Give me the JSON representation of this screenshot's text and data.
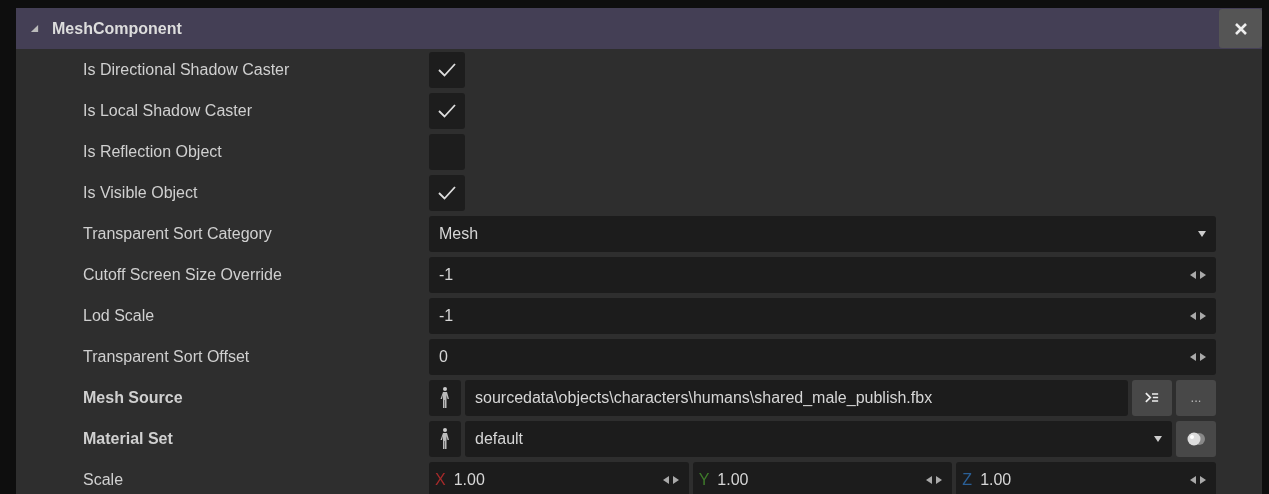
{
  "panel": {
    "title": "MeshComponent",
    "expanded": true
  },
  "rows": [
    {
      "kind": "checkbox",
      "label": "Is Directional Shadow Caster",
      "bold": false,
      "checked": true
    },
    {
      "kind": "checkbox",
      "label": "Is Local Shadow Caster",
      "bold": false,
      "checked": true
    },
    {
      "kind": "checkbox",
      "label": "Is Reflection Object",
      "bold": false,
      "checked": false
    },
    {
      "kind": "checkbox",
      "label": "Is Visible Object",
      "bold": false,
      "checked": true
    },
    {
      "kind": "dropdown",
      "label": "Transparent Sort Category",
      "bold": false,
      "value": "Mesh"
    },
    {
      "kind": "number",
      "label": "Cutoff Screen Size Override",
      "bold": false,
      "value": "-1"
    },
    {
      "kind": "number",
      "label": "Lod Scale",
      "bold": false,
      "value": "-1"
    },
    {
      "kind": "number",
      "label": "Transparent Sort Offset",
      "bold": false,
      "value": "0"
    },
    {
      "kind": "asset",
      "label": "Mesh Source",
      "bold": true,
      "value": "sourcedata\\objects\\characters\\humans\\shared_male_publish.fbx",
      "browse": "..."
    },
    {
      "kind": "material",
      "label": "Material Set",
      "bold": true,
      "value": "default"
    },
    {
      "kind": "vector",
      "label": "Scale",
      "bold": false,
      "components": [
        {
          "axis": "X",
          "value": "1.00",
          "color": "#a52a2a"
        },
        {
          "axis": "Y",
          "value": "1.00",
          "color": "#3e7a2a"
        },
        {
          "axis": "Z",
          "value": "1.00",
          "color": "#2a5f96"
        }
      ]
    }
  ]
}
